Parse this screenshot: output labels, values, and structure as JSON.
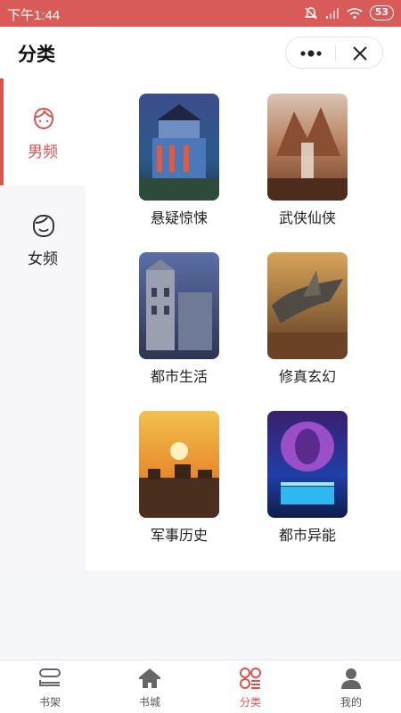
{
  "status_bar": {
    "time": "下午1:44",
    "battery": "53"
  },
  "nav": {
    "title": "分类"
  },
  "sidebar": {
    "tabs": [
      {
        "label": "男频",
        "active": true
      },
      {
        "label": "女频",
        "active": false
      }
    ]
  },
  "categories": [
    {
      "label": "悬疑惊悚",
      "cover_icon": "palace-tower-cover"
    },
    {
      "label": "武侠仙侠",
      "cover_icon": "mountain-waterfall-cover"
    },
    {
      "label": "都市生活",
      "cover_icon": "city-buildings-cover"
    },
    {
      "label": "修真玄幻",
      "cover_icon": "dragon-cover"
    },
    {
      "label": "军事历史",
      "cover_icon": "sunset-city-cover"
    },
    {
      "label": "都市异能",
      "cover_icon": "neon-portal-cover"
    }
  ],
  "tabbar": {
    "items": [
      {
        "label": "书架",
        "active": false
      },
      {
        "label": "书城",
        "active": false
      },
      {
        "label": "分类",
        "active": true
      },
      {
        "label": "我的",
        "active": false
      }
    ]
  },
  "colors": {
    "accent": "#d9534f",
    "status_bar": "#d95b57"
  }
}
